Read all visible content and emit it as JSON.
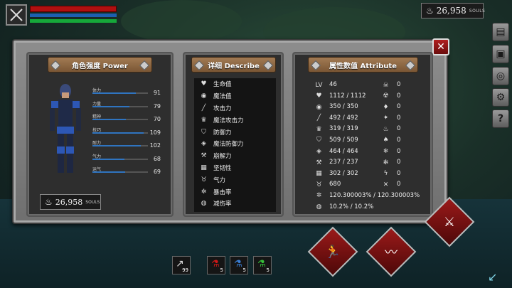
{
  "hud": {
    "hp_fill": 1.0,
    "mp_fill": 1.0,
    "stamina_fill": 1.0
  },
  "souls_top": {
    "value": "26,958",
    "unit": "SOULS"
  },
  "headers": {
    "power": "角色强度 Power",
    "describe": "详细 Describe",
    "attribute": "属性数值 Attribute"
  },
  "stats": [
    {
      "label": "体力",
      "value": "91",
      "fill": 0.78
    },
    {
      "label": "力量",
      "value": "79",
      "fill": 0.67
    },
    {
      "label": "精神",
      "value": "70",
      "fill": 0.6
    },
    {
      "label": "技巧",
      "value": "109",
      "fill": 0.92
    },
    {
      "label": "耐力",
      "value": "102",
      "fill": 0.87
    },
    {
      "label": "气力",
      "value": "68",
      "fill": 0.58
    },
    {
      "label": "运气",
      "value": "69",
      "fill": 0.59
    }
  ],
  "souls_panel": {
    "value": "26,958",
    "unit": "SOULS"
  },
  "describe": [
    {
      "icon": "heart-icon",
      "glyph": "♥",
      "label": "生命值"
    },
    {
      "icon": "mana-icon",
      "glyph": "◉",
      "label": "魔法值"
    },
    {
      "icon": "sword-icon",
      "glyph": "╱",
      "label": "攻击力"
    },
    {
      "icon": "magic-attack-icon",
      "glyph": "♛",
      "label": "魔法攻击力"
    },
    {
      "icon": "shield-icon",
      "glyph": "⛉",
      "label": "防御力"
    },
    {
      "icon": "magic-shield-icon",
      "glyph": "◈",
      "label": "魔法防御力"
    },
    {
      "icon": "break-icon",
      "glyph": "⚒",
      "label": "崩解力"
    },
    {
      "icon": "toughness-icon",
      "glyph": "▦",
      "label": "坚韧性"
    },
    {
      "icon": "lungs-icon",
      "glyph": "♉",
      "label": "气力"
    },
    {
      "icon": "crit-icon",
      "glyph": "✲",
      "label": "暴击率"
    },
    {
      "icon": "reduction-icon",
      "glyph": "◍",
      "label": "减伤率"
    }
  ],
  "attributes": [
    {
      "icon": "lv-icon",
      "glyph": "LV",
      "value": "46",
      "icon2": "skull-icon",
      "glyph2": "☠",
      "value2": "0"
    },
    {
      "icon": "heart-icon",
      "glyph": "♥",
      "value": "1112 / 1112",
      "icon2": "poison-icon",
      "glyph2": "☢",
      "value2": "0"
    },
    {
      "icon": "mana-icon",
      "glyph": "◉",
      "value": "350 / 350",
      "icon2": "water-icon",
      "glyph2": "♦",
      "value2": "0"
    },
    {
      "icon": "sword-icon",
      "glyph": "╱",
      "value": "492 / 492",
      "icon2": "bleed-icon",
      "glyph2": "✦",
      "value2": "0"
    },
    {
      "icon": "magic-attack-icon",
      "glyph": "♛",
      "value": "319 / 319",
      "icon2": "fire-icon",
      "glyph2": "♨",
      "value2": "0"
    },
    {
      "icon": "shield-icon",
      "glyph": "⛉",
      "value": "509 / 509",
      "icon2": "flame-icon",
      "glyph2": "♠",
      "value2": "0"
    },
    {
      "icon": "magic-shield-icon",
      "glyph": "◈",
      "value": "464 / 464",
      "icon2": "frost-icon",
      "glyph2": "❄",
      "value2": "0"
    },
    {
      "icon": "break-icon",
      "glyph": "⚒",
      "value": "237 / 237",
      "icon2": "ice-icon",
      "glyph2": "✻",
      "value2": "0"
    },
    {
      "icon": "toughness-icon",
      "glyph": "▦",
      "value": "302 / 302",
      "icon2": "lightning-icon",
      "glyph2": "ϟ",
      "value2": "0"
    },
    {
      "icon": "lungs-icon",
      "glyph": "♉",
      "value": "680",
      "icon2": "dark-icon",
      "glyph2": "✕",
      "value2": "0"
    },
    {
      "icon": "crit-icon",
      "glyph": "✲",
      "value": "120.300003% / 120.300003%"
    },
    {
      "icon": "reduction-icon",
      "glyph": "◍",
      "value": "10.2% / 10.2%"
    }
  ],
  "items": [
    {
      "name": "arrow-slot",
      "count": "99"
    },
    {
      "name": "red-potion-slot",
      "count": "5"
    },
    {
      "name": "blue-potion-slot",
      "count": "5"
    },
    {
      "name": "green-potion-slot",
      "count": "5"
    }
  ]
}
